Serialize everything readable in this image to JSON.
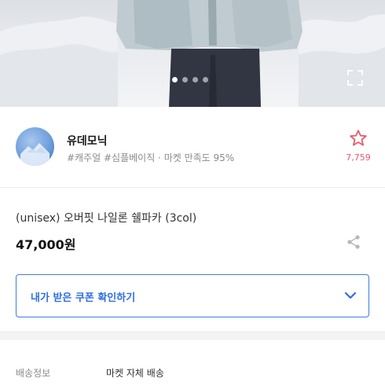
{
  "hero": {
    "image_alt": "product-photo",
    "dots_total": 4,
    "dots_active_index": 0,
    "expand_icon": "expand-icon"
  },
  "shop": {
    "name": "유데모닉",
    "tags": "#캐주얼 #심플베이직 · 마켓 만족도 95%",
    "favorite_icon": "star-outline-icon",
    "favorite_count": "7,759",
    "accent_color": "#e8586a"
  },
  "product": {
    "title": "(unisex) 오버핏 나일론 쉘파카 (3col)",
    "price": "47,000원",
    "share_icon": "share-icon"
  },
  "coupon": {
    "label": "내가 받은 쿠폰 확인하기",
    "chevron_icon": "chevron-down-icon",
    "accent_color": "#2f6fe0"
  },
  "shipping": {
    "label": "배송정보",
    "value": "마켓 자체 배송"
  }
}
